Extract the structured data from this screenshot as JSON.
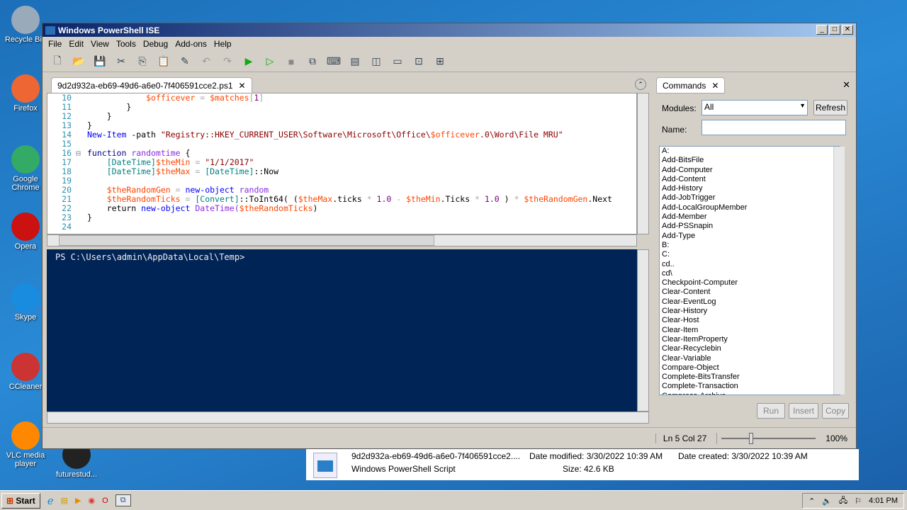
{
  "desktop": [
    "Recycle Bin",
    "Firefox",
    "Google Chrome",
    "Opera",
    "Skype",
    "CCleaner",
    "VLC media player",
    "futurestud..."
  ],
  "window": {
    "title": "Windows PowerShell ISE"
  },
  "menu": [
    "File",
    "Edit",
    "View",
    "Tools",
    "Debug",
    "Add-ons",
    "Help"
  ],
  "editor": {
    "tab": "9d2d932a-eb69-49d6-a6e0-7f406591cce2.ps1",
    "lines": [
      {
        "n": "10",
        "t": [
          [
            "            ",
            ""
          ],
          [
            "$officever",
            "var"
          ],
          [
            " = ",
            "op"
          ],
          [
            "$matches",
            "var"
          ],
          [
            "[",
            "op"
          ],
          [
            "1",
            "num"
          ],
          [
            "]",
            "op"
          ]
        ]
      },
      {
        "n": "11",
        "t": [
          [
            "        }",
            "mem"
          ]
        ]
      },
      {
        "n": "12",
        "t": [
          [
            "    }",
            "mem"
          ]
        ]
      },
      {
        "n": "13",
        "t": [
          [
            "}",
            "mem"
          ]
        ]
      },
      {
        "n": "14",
        "t": [
          [
            "New-Item",
            "cmd"
          ],
          [
            " -path ",
            "mem"
          ],
          [
            "\"Registry::HKEY_CURRENT_USER\\Software\\Microsoft\\Office\\",
            "str"
          ],
          [
            "$officever",
            "var"
          ],
          [
            ".0\\Word\\File MRU\"",
            "str"
          ]
        ]
      },
      {
        "n": "15",
        "t": []
      },
      {
        "n": "16",
        "t": [
          [
            "function",
            "kw"
          ],
          [
            " randomtime ",
            "fn"
          ],
          [
            "{",
            "mem"
          ]
        ]
      },
      {
        "n": "17",
        "t": [
          [
            "    ",
            ""
          ],
          [
            "[DateTime]",
            "type"
          ],
          [
            "$theMin",
            "var"
          ],
          [
            " = ",
            "op"
          ],
          [
            "\"1/1/2017\"",
            "str"
          ]
        ]
      },
      {
        "n": "18",
        "t": [
          [
            "    ",
            ""
          ],
          [
            "[DateTime]",
            "type"
          ],
          [
            "$theMax",
            "var"
          ],
          [
            " = ",
            "op"
          ],
          [
            "[DateTime]",
            "type"
          ],
          [
            "::Now",
            "mem"
          ]
        ]
      },
      {
        "n": "19",
        "t": []
      },
      {
        "n": "20",
        "t": [
          [
            "    ",
            ""
          ],
          [
            "$theRandomGen",
            "var"
          ],
          [
            " = ",
            "op"
          ],
          [
            "new-object",
            "cmd"
          ],
          [
            " random",
            "fn"
          ]
        ]
      },
      {
        "n": "21",
        "t": [
          [
            "    ",
            ""
          ],
          [
            "$theRandomTicks",
            "var"
          ],
          [
            " = ",
            "op"
          ],
          [
            "[Convert]",
            "type"
          ],
          [
            "::ToInt64( (",
            "mem"
          ],
          [
            "$theMax",
            "var"
          ],
          [
            ".ticks ",
            "mem"
          ],
          [
            "* ",
            "op"
          ],
          [
            "1.0",
            "num"
          ],
          [
            " - ",
            "op"
          ],
          [
            "$theMin",
            "var"
          ],
          [
            ".Ticks ",
            "mem"
          ],
          [
            "* ",
            "op"
          ],
          [
            "1.0",
            "num"
          ],
          [
            " ) ",
            "mem"
          ],
          [
            "* ",
            "op"
          ],
          [
            "$theRandomGen",
            "var"
          ],
          [
            ".Next",
            "mem"
          ]
        ]
      },
      {
        "n": "22",
        "t": [
          [
            "    return ",
            "mem"
          ],
          [
            "new-object",
            "cmd"
          ],
          [
            " DateTime(",
            "fn"
          ],
          [
            "$theRandomTicks",
            "var"
          ],
          [
            ")",
            "mem"
          ]
        ]
      },
      {
        "n": "23",
        "t": [
          [
            "}",
            "mem"
          ]
        ]
      },
      {
        "n": "24",
        "t": []
      }
    ]
  },
  "console": {
    "prompt": "PS C:\\Users\\admin\\AppData\\Local\\Temp>"
  },
  "commands": {
    "tab": "Commands",
    "modules_label": "Modules:",
    "modules_value": "All",
    "refresh": "Refresh",
    "name_label": "Name:",
    "name_value": "",
    "items": [
      "A:",
      "Add-BitsFile",
      "Add-Computer",
      "Add-Content",
      "Add-History",
      "Add-JobTrigger",
      "Add-LocalGroupMember",
      "Add-Member",
      "Add-PSSnapin",
      "Add-Type",
      "B:",
      "C:",
      "cd..",
      "cd\\",
      "Checkpoint-Computer",
      "Clear-Content",
      "Clear-EventLog",
      "Clear-History",
      "Clear-Host",
      "Clear-Item",
      "Clear-ItemProperty",
      "Clear-Recyclebin",
      "Clear-Variable",
      "Compare-Object",
      "Complete-BitsTransfer",
      "Complete-Transaction",
      "Compress-Archive"
    ],
    "run": "Run",
    "insert": "Insert",
    "copy": "Copy"
  },
  "status": {
    "position": "Ln 5  Col 27",
    "zoom": "100%",
    "zoom_fraction": 0.3
  },
  "explorer": {
    "name": "9d2d932a-eb69-49d6-a6e0-7f406591cce2....",
    "modified": "Date modified: 3/30/2022 10:39 AM",
    "created": "Date created: 3/30/2022 10:39 AM",
    "type": "Windows PowerShell Script",
    "size": "Size: 42.6 KB"
  },
  "taskbar": {
    "start": "Start",
    "clock": "4:01 PM"
  }
}
